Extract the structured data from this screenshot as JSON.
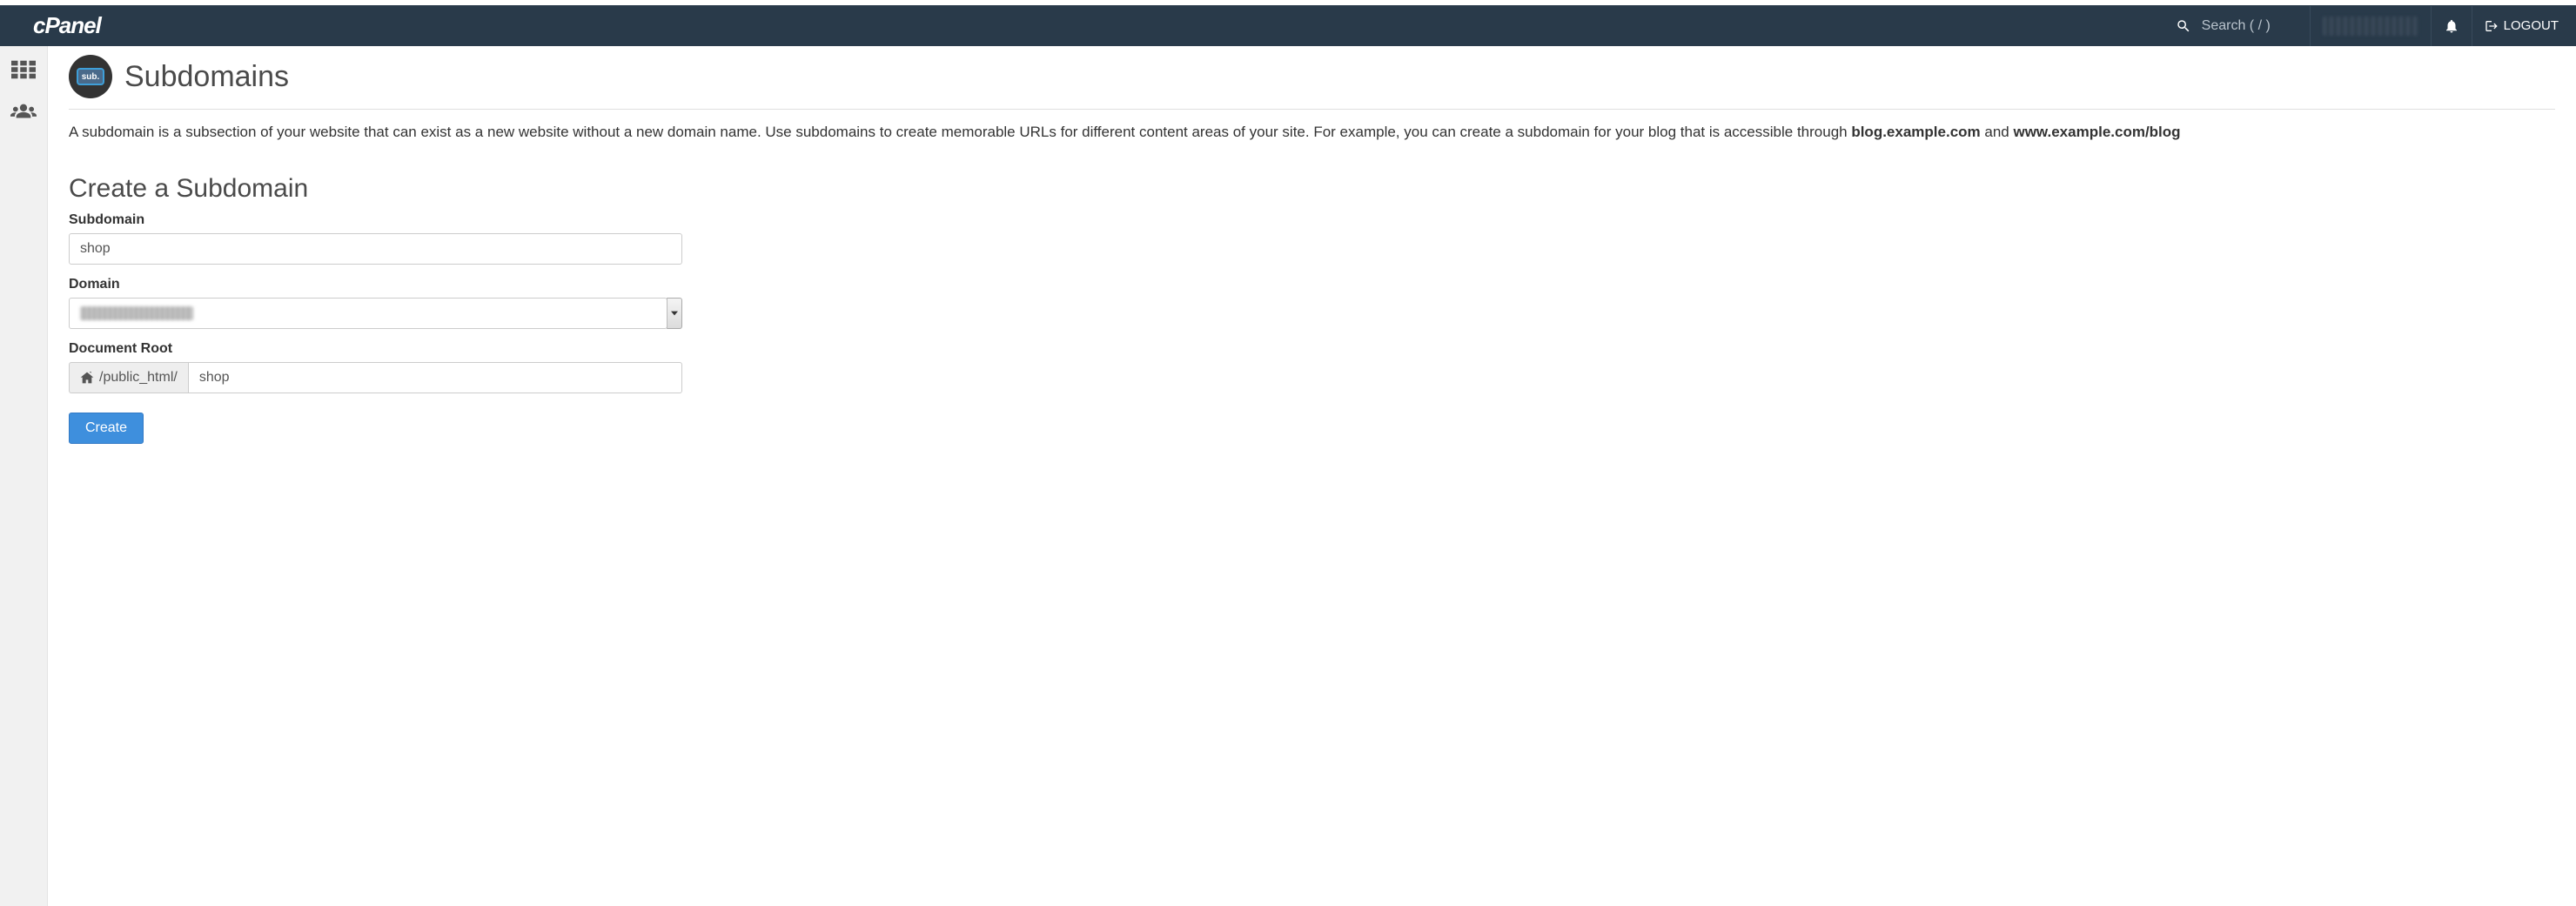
{
  "header": {
    "logo_text": "cPanel",
    "search_placeholder": "Search ( / )",
    "logout_label": "LOGOUT"
  },
  "page": {
    "icon_label": "sub.",
    "title": "Subdomains",
    "description_1": "A subdomain is a subsection of your website that can exist as a new website without a new domain name. Use subdomains to create memorable URLs for different content areas of your site. For example, you can create a subdomain for your blog that is accessible through ",
    "description_bold1": "blog.example.com",
    "description_and": " and ",
    "description_bold2": "www.example.com/blog"
  },
  "form": {
    "section_title": "Create a Subdomain",
    "subdomain_label": "Subdomain",
    "subdomain_value": "shop",
    "domain_label": "Domain",
    "docroot_label": "Document Root",
    "docroot_prefix": "/public_html/",
    "docroot_value": "shop",
    "submit_label": "Create"
  }
}
